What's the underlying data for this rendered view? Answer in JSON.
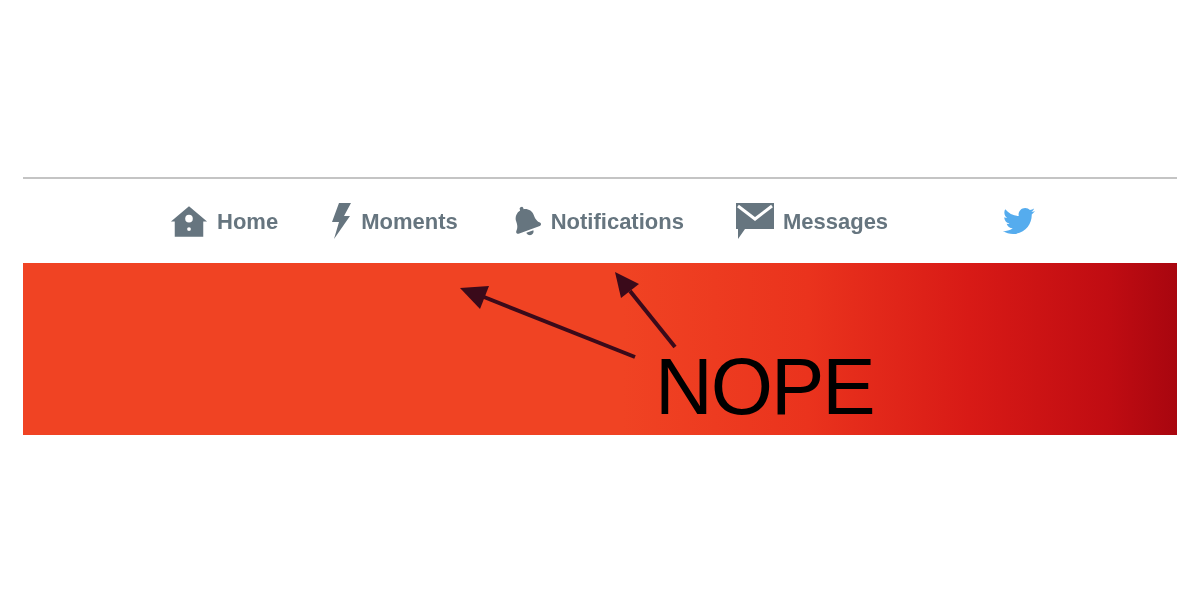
{
  "nav": {
    "items": [
      {
        "kind": "home",
        "label": "Home"
      },
      {
        "kind": "moments",
        "label": "Moments"
      },
      {
        "kind": "notifications",
        "label": "Notifications"
      },
      {
        "kind": "messages",
        "label": "Messages"
      }
    ]
  },
  "banner": {
    "annotation": "NOPE"
  }
}
